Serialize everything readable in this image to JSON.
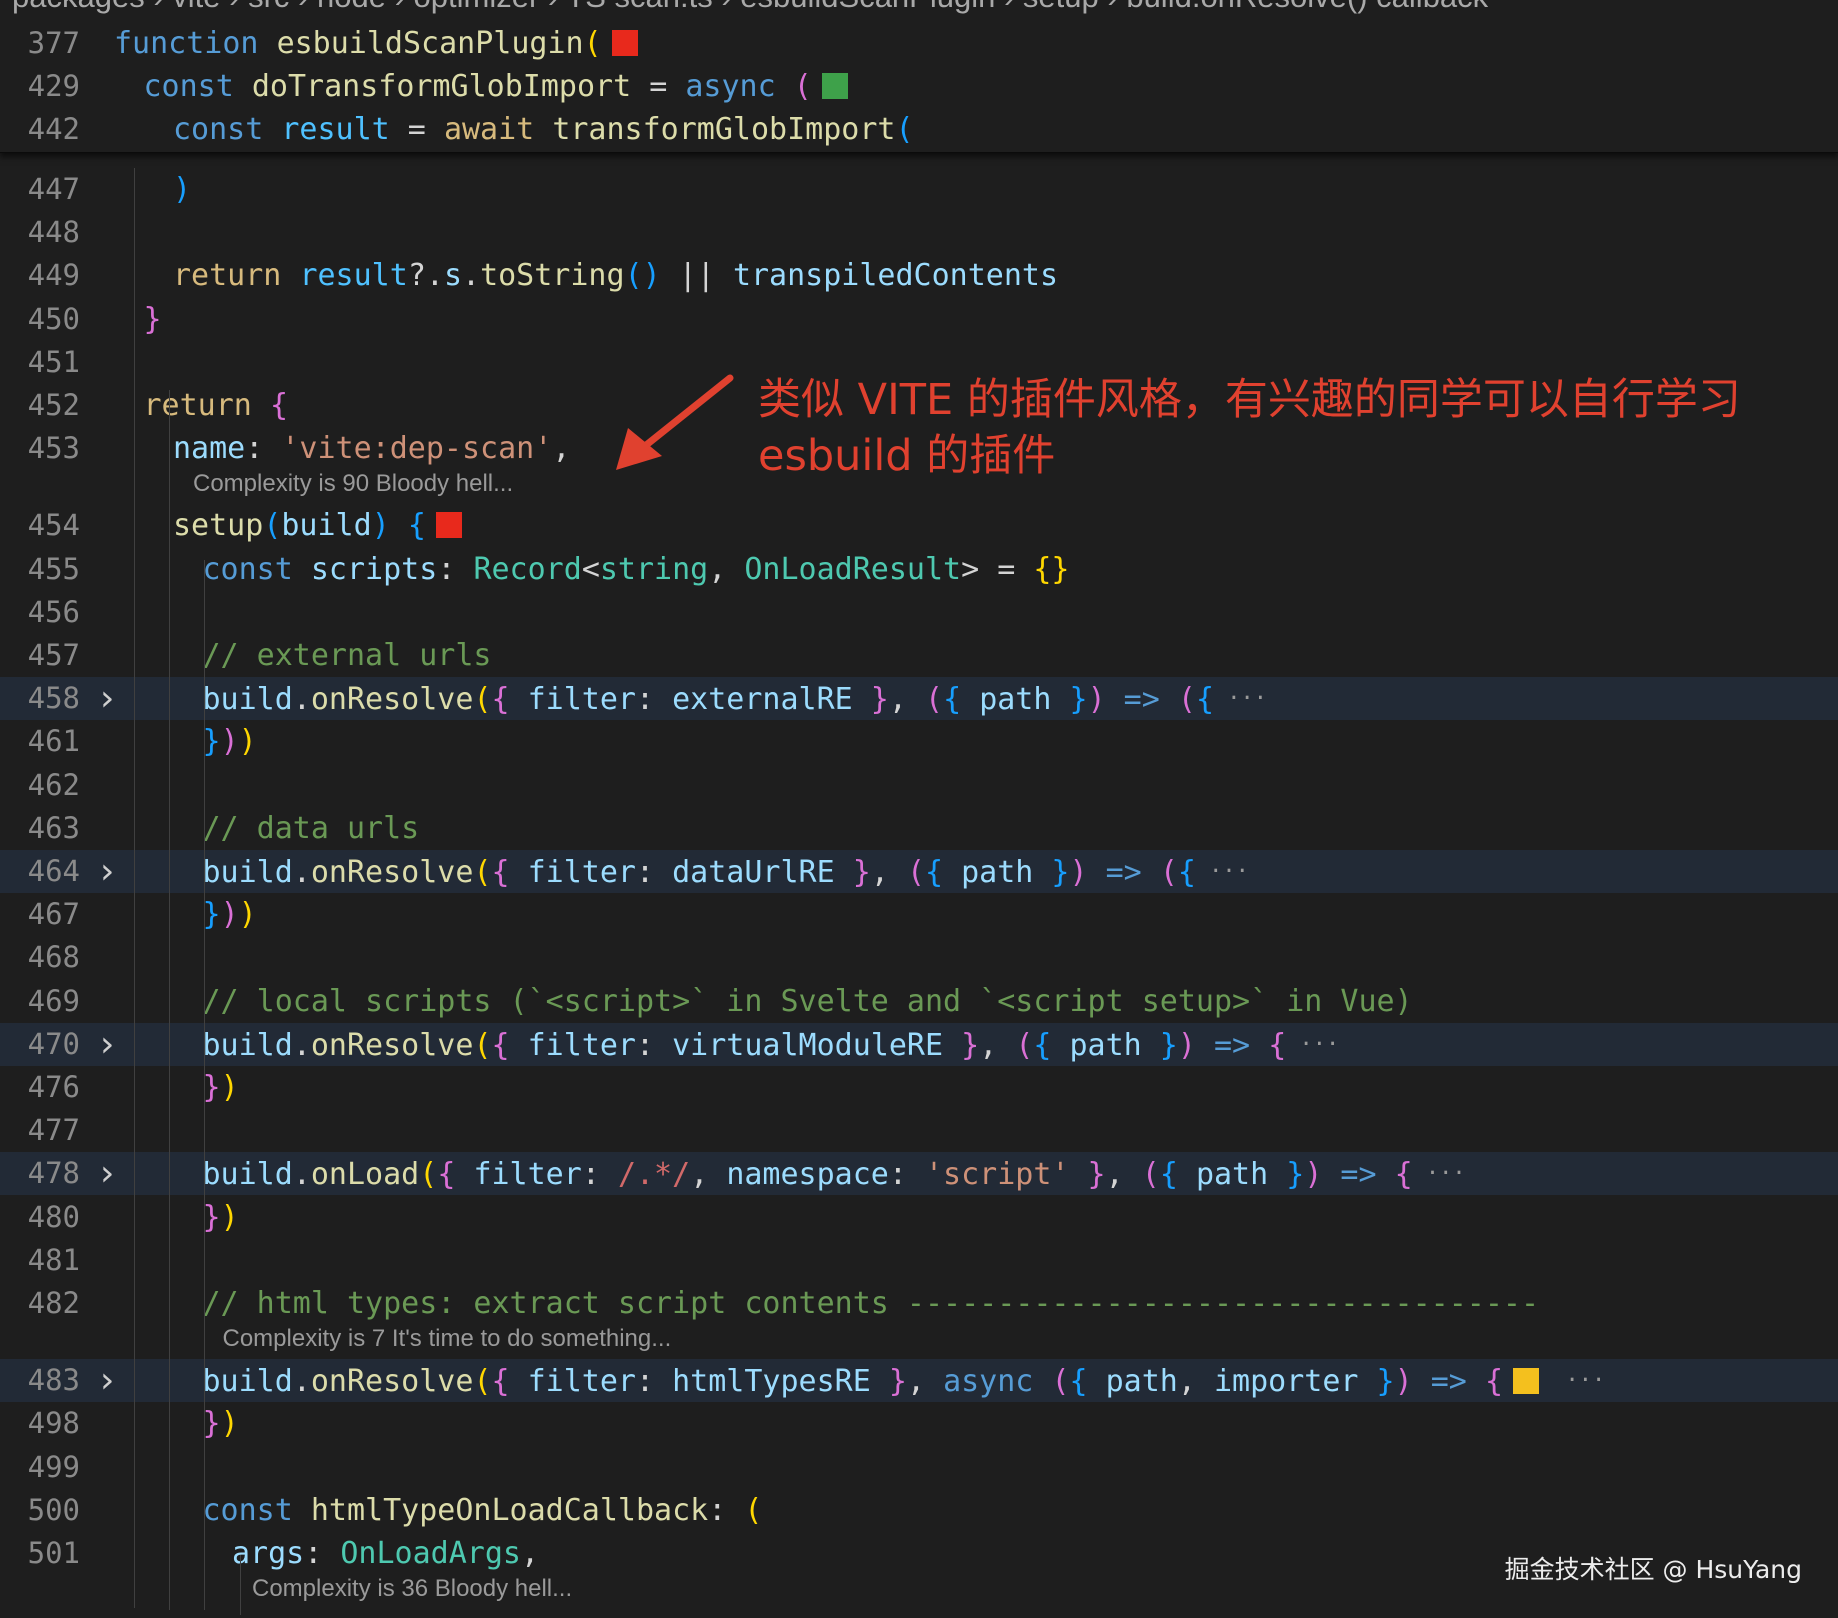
{
  "breadcrumb": {
    "items": [
      "packages",
      "vite",
      "src",
      "node",
      "optimizer",
      "TS scan.ts",
      "esbuildScanPlugin",
      "setup",
      "build.onResolve() callback"
    ],
    "separator": "›"
  },
  "sticky_lines": [
    {
      "number": "377",
      "tokens": [
        [
          "function ",
          "kw"
        ],
        [
          "esbuildScanPlugin",
          "fn"
        ],
        [
          "(",
          "b1"
        ]
      ],
      "marker": "#e8291c"
    },
    {
      "number": "429",
      "tokens": [
        [
          "const ",
          "kw"
        ],
        [
          "doTransformGlobImport",
          "fn"
        ],
        [
          " = ",
          "op"
        ],
        [
          "async",
          "kw"
        ],
        [
          " (",
          "b2"
        ]
      ],
      "marker": "#3ea14a"
    },
    {
      "number": "442",
      "tokens": [
        [
          "const ",
          "kw"
        ],
        [
          "result",
          "cst"
        ],
        [
          " = ",
          "op"
        ],
        [
          "await ",
          "ctl"
        ],
        [
          "transformGlobImport",
          "fn"
        ],
        [
          "(",
          "b3"
        ]
      ]
    }
  ],
  "lines": [
    {
      "number": "447",
      "indent": 2,
      "tokens": [
        [
          ")",
          "b3"
        ]
      ]
    },
    {
      "number": "448",
      "indent": 0,
      "tokens": []
    },
    {
      "number": "449",
      "indent": 2,
      "tokens": [
        [
          "return ",
          "ctl"
        ],
        [
          "result",
          "cst"
        ],
        [
          "?.",
          "op"
        ],
        [
          "s",
          "var"
        ],
        [
          ".",
          "op"
        ],
        [
          "toString",
          "fn"
        ],
        [
          "()",
          "b3"
        ],
        [
          " || ",
          "op"
        ],
        [
          "transpiledContents",
          "var"
        ]
      ]
    },
    {
      "number": "450",
      "indent": 1,
      "tokens": [
        [
          "}",
          "b2"
        ]
      ]
    },
    {
      "number": "451",
      "indent": 0,
      "tokens": []
    },
    {
      "number": "452",
      "indent": 1,
      "tokens": [
        [
          "return ",
          "ctl"
        ],
        [
          "{",
          "b2"
        ]
      ]
    },
    {
      "number": "453",
      "indent": 2,
      "tokens": [
        [
          "name",
          "var"
        ],
        [
          ": ",
          "op"
        ],
        [
          "'vite:dep-scan'",
          "str"
        ],
        [
          ",",
          "op"
        ]
      ],
      "codelens_after": "Complexity is 90 Bloody hell..."
    },
    {
      "number": "454",
      "indent": 2,
      "tokens": [
        [
          "setup",
          "fn"
        ],
        [
          "(",
          "b3"
        ],
        [
          "build",
          "var"
        ],
        [
          ") ",
          "b3"
        ],
        [
          "{",
          "b3"
        ]
      ],
      "marker": "#e8291c"
    },
    {
      "number": "455",
      "indent": 3,
      "tokens": [
        [
          "const ",
          "kw"
        ],
        [
          "scripts",
          "var"
        ],
        [
          ": ",
          "op"
        ],
        [
          "Record",
          "type"
        ],
        [
          "<",
          "op"
        ],
        [
          "string",
          "type"
        ],
        [
          ", ",
          "op"
        ],
        [
          "OnLoadResult",
          "type"
        ],
        [
          "> = ",
          "op"
        ],
        [
          "{}",
          "b1"
        ]
      ]
    },
    {
      "number": "456",
      "indent": 0,
      "tokens": []
    },
    {
      "number": "457",
      "indent": 3,
      "tokens": [
        [
          "// external urls",
          "cmt"
        ]
      ]
    },
    {
      "number": "458",
      "indent": 3,
      "folded": true,
      "tokens": [
        [
          "build",
          "var"
        ],
        [
          ".",
          "op"
        ],
        [
          "onResolve",
          "fn"
        ],
        [
          "(",
          "b1"
        ],
        [
          "{ ",
          "b2"
        ],
        [
          "filter",
          "var"
        ],
        [
          ": ",
          "op"
        ],
        [
          "externalRE",
          "var"
        ],
        [
          " }",
          "b2"
        ],
        [
          ", ",
          "op"
        ],
        [
          "(",
          "b2"
        ],
        [
          "{ ",
          "b3"
        ],
        [
          "path",
          "var"
        ],
        [
          " }",
          "b3"
        ],
        [
          ")",
          "b2"
        ],
        [
          " => ",
          "kw"
        ],
        [
          "(",
          "b2"
        ],
        [
          "{",
          "b3"
        ]
      ],
      "ellipsis": "···"
    },
    {
      "number": "461",
      "indent": 3,
      "tokens": [
        [
          "}",
          "b3"
        ],
        [
          ")",
          "b2"
        ],
        [
          ")",
          "b1"
        ]
      ]
    },
    {
      "number": "462",
      "indent": 0,
      "tokens": []
    },
    {
      "number": "463",
      "indent": 3,
      "tokens": [
        [
          "// data urls",
          "cmt"
        ]
      ]
    },
    {
      "number": "464",
      "indent": 3,
      "folded": true,
      "tokens": [
        [
          "build",
          "var"
        ],
        [
          ".",
          "op"
        ],
        [
          "onResolve",
          "fn"
        ],
        [
          "(",
          "b1"
        ],
        [
          "{ ",
          "b2"
        ],
        [
          "filter",
          "var"
        ],
        [
          ": ",
          "op"
        ],
        [
          "dataUrlRE",
          "var"
        ],
        [
          " }",
          "b2"
        ],
        [
          ", ",
          "op"
        ],
        [
          "(",
          "b2"
        ],
        [
          "{ ",
          "b3"
        ],
        [
          "path",
          "var"
        ],
        [
          " }",
          "b3"
        ],
        [
          ")",
          "b2"
        ],
        [
          " => ",
          "kw"
        ],
        [
          "(",
          "b2"
        ],
        [
          "{",
          "b3"
        ]
      ],
      "ellipsis": "···"
    },
    {
      "number": "467",
      "indent": 3,
      "tokens": [
        [
          "}",
          "b3"
        ],
        [
          ")",
          "b2"
        ],
        [
          ")",
          "b1"
        ]
      ]
    },
    {
      "number": "468",
      "indent": 0,
      "tokens": []
    },
    {
      "number": "469",
      "indent": 3,
      "tokens": [
        [
          "// local scripts (`<script>` in Svelte and `<script setup>` in Vue)",
          "cmt"
        ]
      ]
    },
    {
      "number": "470",
      "indent": 3,
      "folded": true,
      "tokens": [
        [
          "build",
          "var"
        ],
        [
          ".",
          "op"
        ],
        [
          "onResolve",
          "fn"
        ],
        [
          "(",
          "b1"
        ],
        [
          "{ ",
          "b2"
        ],
        [
          "filter",
          "var"
        ],
        [
          ": ",
          "op"
        ],
        [
          "virtualModuleRE",
          "var"
        ],
        [
          " }",
          "b2"
        ],
        [
          ", ",
          "op"
        ],
        [
          "(",
          "b2"
        ],
        [
          "{ ",
          "b3"
        ],
        [
          "path",
          "var"
        ],
        [
          " }",
          "b3"
        ],
        [
          ")",
          "b2"
        ],
        [
          " => ",
          "kw"
        ],
        [
          "{",
          "b2"
        ]
      ],
      "ellipsis": "···"
    },
    {
      "number": "476",
      "indent": 3,
      "tokens": [
        [
          "}",
          "b2"
        ],
        [
          ")",
          "b1"
        ]
      ]
    },
    {
      "number": "477",
      "indent": 0,
      "tokens": []
    },
    {
      "number": "478",
      "indent": 3,
      "folded": true,
      "tokens": [
        [
          "build",
          "var"
        ],
        [
          ".",
          "op"
        ],
        [
          "onLoad",
          "fn"
        ],
        [
          "(",
          "b1"
        ],
        [
          "{ ",
          "b2"
        ],
        [
          "filter",
          "var"
        ],
        [
          ": ",
          "op"
        ],
        [
          "/.*/",
          "rx"
        ],
        [
          ", ",
          "op"
        ],
        [
          "namespace",
          "var"
        ],
        [
          ": ",
          "op"
        ],
        [
          "'script'",
          "str"
        ],
        [
          " }",
          "b2"
        ],
        [
          ", ",
          "op"
        ],
        [
          "(",
          "b2"
        ],
        [
          "{ ",
          "b3"
        ],
        [
          "path",
          "var"
        ],
        [
          " }",
          "b3"
        ],
        [
          ")",
          "b2"
        ],
        [
          " => ",
          "kw"
        ],
        [
          "{",
          "b2"
        ]
      ],
      "ellipsis": "···"
    },
    {
      "number": "480",
      "indent": 3,
      "tokens": [
        [
          "}",
          "b2"
        ],
        [
          ")",
          "b1"
        ]
      ]
    },
    {
      "number": "481",
      "indent": 0,
      "tokens": []
    },
    {
      "number": "482",
      "indent": 3,
      "tokens": [
        [
          "// html types: extract script contents -----------------------------------",
          "cmt"
        ]
      ],
      "codelens_after": "Complexity is 7 It's time to do something..."
    },
    {
      "number": "483",
      "indent": 3,
      "folded": true,
      "tokens": [
        [
          "build",
          "var"
        ],
        [
          ".",
          "op"
        ],
        [
          "onResolve",
          "fn"
        ],
        [
          "(",
          "b1"
        ],
        [
          "{ ",
          "b2"
        ],
        [
          "filter",
          "var"
        ],
        [
          ": ",
          "op"
        ],
        [
          "htmlTypesRE",
          "var"
        ],
        [
          " }",
          "b2"
        ],
        [
          ", ",
          "op"
        ],
        [
          "async ",
          "kw"
        ],
        [
          "(",
          "b2"
        ],
        [
          "{ ",
          "b3"
        ],
        [
          "path",
          "var"
        ],
        [
          ", ",
          "op"
        ],
        [
          "importer",
          "var"
        ],
        [
          " }",
          "b3"
        ],
        [
          ")",
          "b2"
        ],
        [
          " => ",
          "kw"
        ],
        [
          "{",
          "b2"
        ]
      ],
      "marker": "#f4c01e",
      "ellipsis": "···"
    },
    {
      "number": "498",
      "indent": 3,
      "tokens": [
        [
          "}",
          "b2"
        ],
        [
          ")",
          "b1"
        ]
      ]
    },
    {
      "number": "499",
      "indent": 0,
      "tokens": []
    },
    {
      "number": "500",
      "indent": 3,
      "tokens": [
        [
          "const ",
          "kw"
        ],
        [
          "htmlTypeOnLoadCallback",
          "fn"
        ],
        [
          ": ",
          "op"
        ],
        [
          "(",
          "b1"
        ]
      ]
    },
    {
      "number": "501",
      "indent": 4,
      "tokens": [
        [
          "args",
          "var"
        ],
        [
          ": ",
          "op"
        ],
        [
          "OnLoadArgs",
          "type"
        ],
        [
          ",",
          "op"
        ]
      ],
      "codelens_after": "Complexity is 36 Bloody hell..."
    }
  ],
  "annotation": {
    "text_line1": "类似 VITE 的插件风格，有兴趣的同学可以自行学习",
    "text_line2": "esbuild 的插件",
    "color": "#e0412f"
  },
  "watermark": "掘金技术社区 @ HsuYang"
}
